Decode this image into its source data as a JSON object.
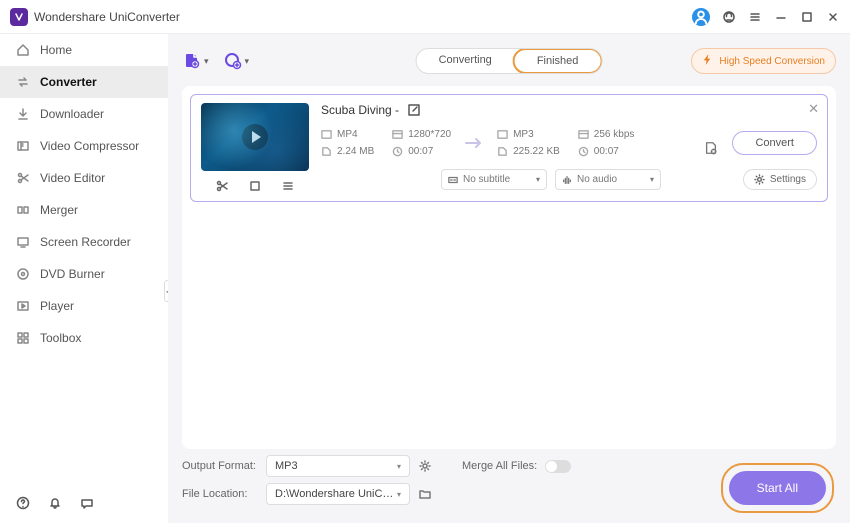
{
  "app": {
    "title": "Wondershare UniConverter"
  },
  "titlebar": {
    "avatar_glyph": "👤"
  },
  "sidebar": {
    "items": [
      {
        "label": "Home"
      },
      {
        "label": "Converter"
      },
      {
        "label": "Downloader"
      },
      {
        "label": "Video Compressor"
      },
      {
        "label": "Video Editor"
      },
      {
        "label": "Merger"
      },
      {
        "label": "Screen Recorder"
      },
      {
        "label": "DVD Burner"
      },
      {
        "label": "Player"
      },
      {
        "label": "Toolbox"
      }
    ],
    "active_index": 1
  },
  "tabs": {
    "converting": "Converting",
    "finished": "Finished",
    "active": "finished"
  },
  "toolbar": {
    "high_speed": "High Speed Conversion"
  },
  "file": {
    "title": "Scuba Diving -",
    "src": {
      "format": "MP4",
      "resolution": "1280*720",
      "size": "2.24 MB",
      "duration": "00:07"
    },
    "dst": {
      "format": "MP3",
      "bitrate": "256 kbps",
      "size": "225.22 KB",
      "duration": "00:07"
    },
    "subtitle": "No subtitle",
    "audio": "No audio",
    "settings_label": "Settings",
    "convert_label": "Convert"
  },
  "bottom": {
    "output_format_label": "Output Format:",
    "output_format_value": "MP3",
    "file_location_label": "File Location:",
    "file_location_value": "D:\\Wondershare UniConverter",
    "merge_label": "Merge All Files:",
    "start_label": "Start All"
  }
}
